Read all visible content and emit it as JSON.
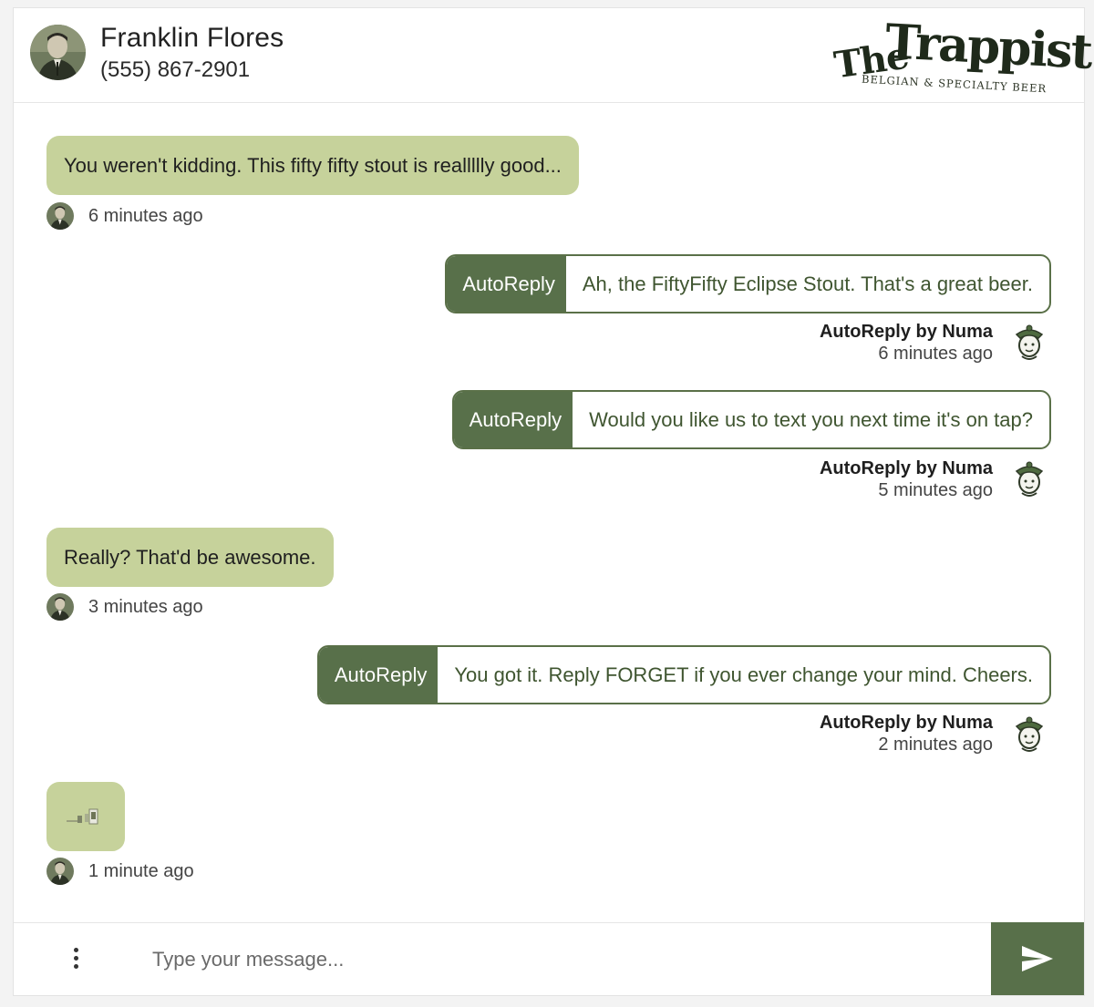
{
  "contact": {
    "name": "Franklin Flores",
    "phone": "(555) 867-2901"
  },
  "brand": {
    "the": "The",
    "name": "Trappist",
    "tagline": "BELGIAN & SPECIALTY BEER"
  },
  "messages": [
    {
      "type": "incoming",
      "text": "You weren't kidding. This fifty fifty stout is reallllly good...",
      "time": "6 minutes ago"
    },
    {
      "type": "autoreply",
      "tag": "AutoReply",
      "text": "Ah, the FiftyFifty Eclipse Stout. That's a great beer.",
      "author": "AutoReply by Numa",
      "time": "6 minutes ago"
    },
    {
      "type": "autoreply",
      "tag": "AutoReply",
      "text": "Would you like us to text you next time it's on tap?",
      "author": "AutoReply by Numa",
      "time": "5 minutes ago"
    },
    {
      "type": "incoming",
      "text": "Really? That'd be awesome.",
      "time": "3 minutes ago"
    },
    {
      "type": "autoreply",
      "tag": "AutoReply",
      "text": "You got it. Reply FORGET if you ever change your mind. Cheers.",
      "author": "AutoReply by Numa",
      "time": "2 minutes ago"
    },
    {
      "type": "incoming-image",
      "time": "1 minute ago"
    }
  ],
  "composer": {
    "placeholder": "Type your message...",
    "menu_icon": "more-vertical-icon",
    "send_icon": "send-icon"
  },
  "colors": {
    "incoming_bubble": "#c6d29b",
    "accent": "#58704a",
    "accent_text": "#3f5530"
  }
}
